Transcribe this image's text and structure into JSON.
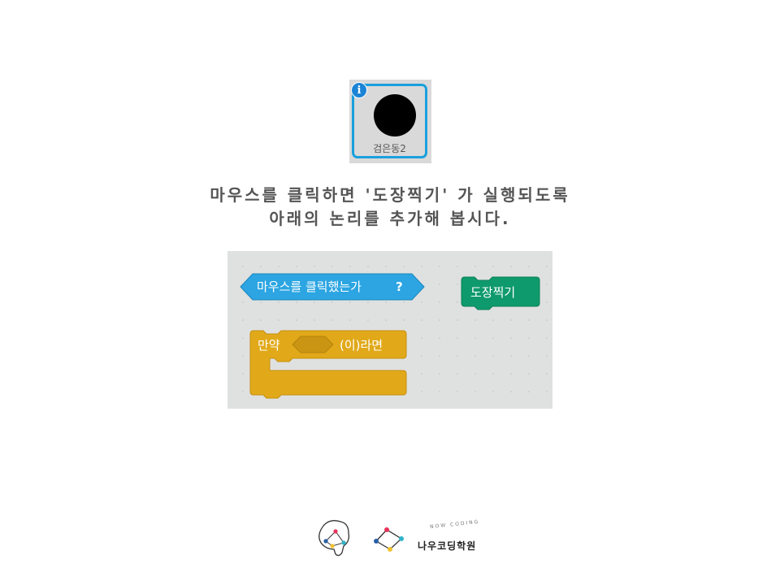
{
  "sprite": {
    "name": "검은동2",
    "info_glyph": "i",
    "ball_color": "#000000",
    "border_color": "#1aa0dd"
  },
  "instructions": {
    "line1": "마우스를 클릭하면  '도장찍기' 가 실행되도록",
    "line2": "아래의 논리를 추가해 봅시다."
  },
  "blocks": {
    "sensing": {
      "label": "마우스를  클릭했는가",
      "suffix": "?",
      "color": "#2ca5e2"
    },
    "stamp": {
      "label": "도장찍기",
      "color": "#0e9a6c"
    },
    "if_block": {
      "label_start": "만약",
      "label_end": "(이)라면",
      "color": "#e1a91a"
    }
  },
  "footer": {
    "academy_name": "나우코딩학원",
    "tagline": "NOW CODING"
  }
}
